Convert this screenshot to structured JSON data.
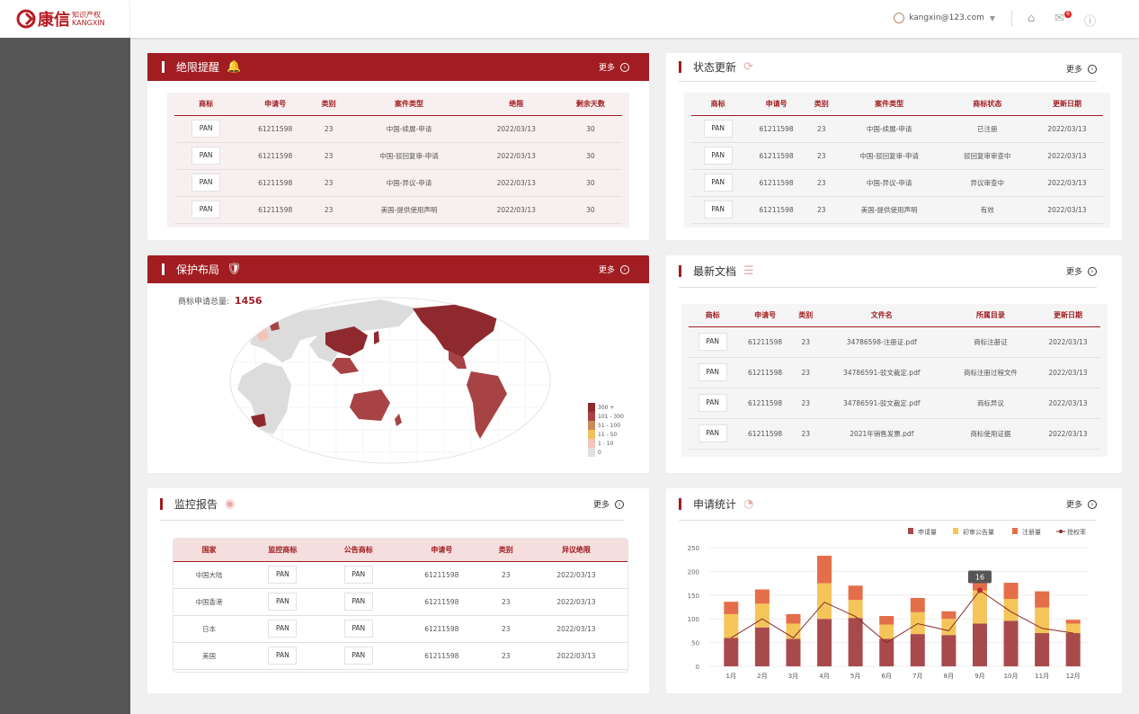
{
  "brand": {
    "name": "康信",
    "sub1": "知识产权",
    "sub2": "KANGXIN"
  },
  "topbar": {
    "user_email": "kangxin@123.com",
    "mail_count": "6"
  },
  "common": {
    "more_label": "更多"
  },
  "deadline": {
    "title": "绝限提醒",
    "headers": [
      "商标",
      "申请号",
      "类别",
      "案件类型",
      "绝限",
      "剩余天数"
    ],
    "rows": [
      [
        "PAN",
        "61211598",
        "23",
        "中国-续展-申请",
        "2022/03/13",
        "30"
      ],
      [
        "PAN",
        "61211598",
        "23",
        "中国-驳回复审-申请",
        "2022/03/13",
        "30"
      ],
      [
        "PAN",
        "61211598",
        "23",
        "中国-异议-申请",
        "2022/03/13",
        "30"
      ],
      [
        "PAN",
        "61211598",
        "23",
        "美国-提供使用声明",
        "2022/03/13",
        "30"
      ]
    ]
  },
  "status": {
    "title": "状态更新",
    "headers": [
      "商标",
      "申请号",
      "类别",
      "案件类型",
      "商标状态",
      "更新日期"
    ],
    "rows": [
      [
        "PAN",
        "61211598",
        "23",
        "中国-续展-申请",
        "已注册",
        "2022/03/13"
      ],
      [
        "PAN",
        "61211598",
        "23",
        "中国-驳回复审-申请",
        "驳回复审审查中",
        "2022/03/13"
      ],
      [
        "PAN",
        "61211598",
        "23",
        "中国-异议-申请",
        "异议审查中",
        "2022/03/13"
      ],
      [
        "PAN",
        "61211598",
        "23",
        "美国-提供使用声明",
        "有效",
        "2022/03/13"
      ]
    ]
  },
  "protection": {
    "title": "保护布局",
    "total_label": "商标申请总量:",
    "total_value": "1456",
    "legend": [
      {
        "label": "300 +",
        "color": "#8e2a2f"
      },
      {
        "label": "101 - 300",
        "color": "#a84345"
      },
      {
        "label": "51 - 100",
        "color": "#c98a5e"
      },
      {
        "label": "11 - 50",
        "color": "#f0c060"
      },
      {
        "label": "1 - 10",
        "color": "#f3c4b8"
      },
      {
        "label": "0",
        "color": "#e0e0e0"
      }
    ]
  },
  "documents": {
    "title": "最新文档",
    "headers": [
      "商标",
      "申请号",
      "类别",
      "文件名",
      "所属目录",
      "更新日期"
    ],
    "rows": [
      [
        "PAN",
        "61211598",
        "23",
        "34786598-注册证.pdf",
        "商标注册证",
        "2022/03/13"
      ],
      [
        "PAN",
        "61211598",
        "23",
        "34786591-驳文裁定.pdf",
        "商标注册过程文件",
        "2022/03/13"
      ],
      [
        "PAN",
        "61211598",
        "23",
        "34786591-驳文裁定.pdf",
        "商标异议",
        "2022/03/13"
      ],
      [
        "PAN",
        "61211598",
        "23",
        "2021年销售发票.pdf",
        "商标使用证据",
        "2022/03/13"
      ]
    ]
  },
  "monitor": {
    "title": "监控报告",
    "headers": [
      "国家",
      "监控商标",
      "公告商标",
      "申请号",
      "类别",
      "异议绝限"
    ],
    "rows": [
      [
        "中国大陆",
        "PAN",
        "PAN",
        "61211598",
        "23",
        "2022/03/13"
      ],
      [
        "中国香港",
        "PAN",
        "PAN",
        "61211598",
        "23",
        "2022/03/13"
      ],
      [
        "日本",
        "PAN",
        "PAN",
        "61211598",
        "23",
        "2022/03/13"
      ],
      [
        "美国",
        "PAN",
        "PAN",
        "61211598",
        "23",
        "2022/03/13"
      ]
    ]
  },
  "stats": {
    "title": "申请统计",
    "tooltip_value": "16"
  },
  "chart_data": {
    "type": "bar",
    "stacked": true,
    "categories": [
      "1月",
      "2月",
      "3月",
      "4月",
      "5月",
      "6月",
      "7月",
      "8月",
      "9月",
      "10月",
      "11月",
      "12月"
    ],
    "ylim": [
      0,
      250
    ],
    "yticks": [
      0,
      50,
      100,
      150,
      200,
      250
    ],
    "series": [
      {
        "name": "申请量",
        "color": "#a84a4c",
        "values": [
          60,
          82,
          58,
          100,
          102,
          58,
          68,
          66,
          90,
          96,
          70,
          70
        ]
      },
      {
        "name": "初审公告量",
        "color": "#f5c55a",
        "values": [
          50,
          50,
          32,
          75,
          38,
          30,
          46,
          34,
          70,
          46,
          54,
          20
        ]
      },
      {
        "name": "注册量",
        "color": "#e56e4a",
        "values": [
          26,
          30,
          20,
          58,
          30,
          18,
          30,
          16,
          40,
          34,
          34,
          8
        ]
      }
    ],
    "line": {
      "name": "授权率",
      "color": "#8a2a2a",
      "values": [
        60,
        100,
        60,
        135,
        105,
        50,
        90,
        75,
        160,
        115,
        80,
        70
      ]
    },
    "legend_position": "top-right",
    "grid": true
  }
}
